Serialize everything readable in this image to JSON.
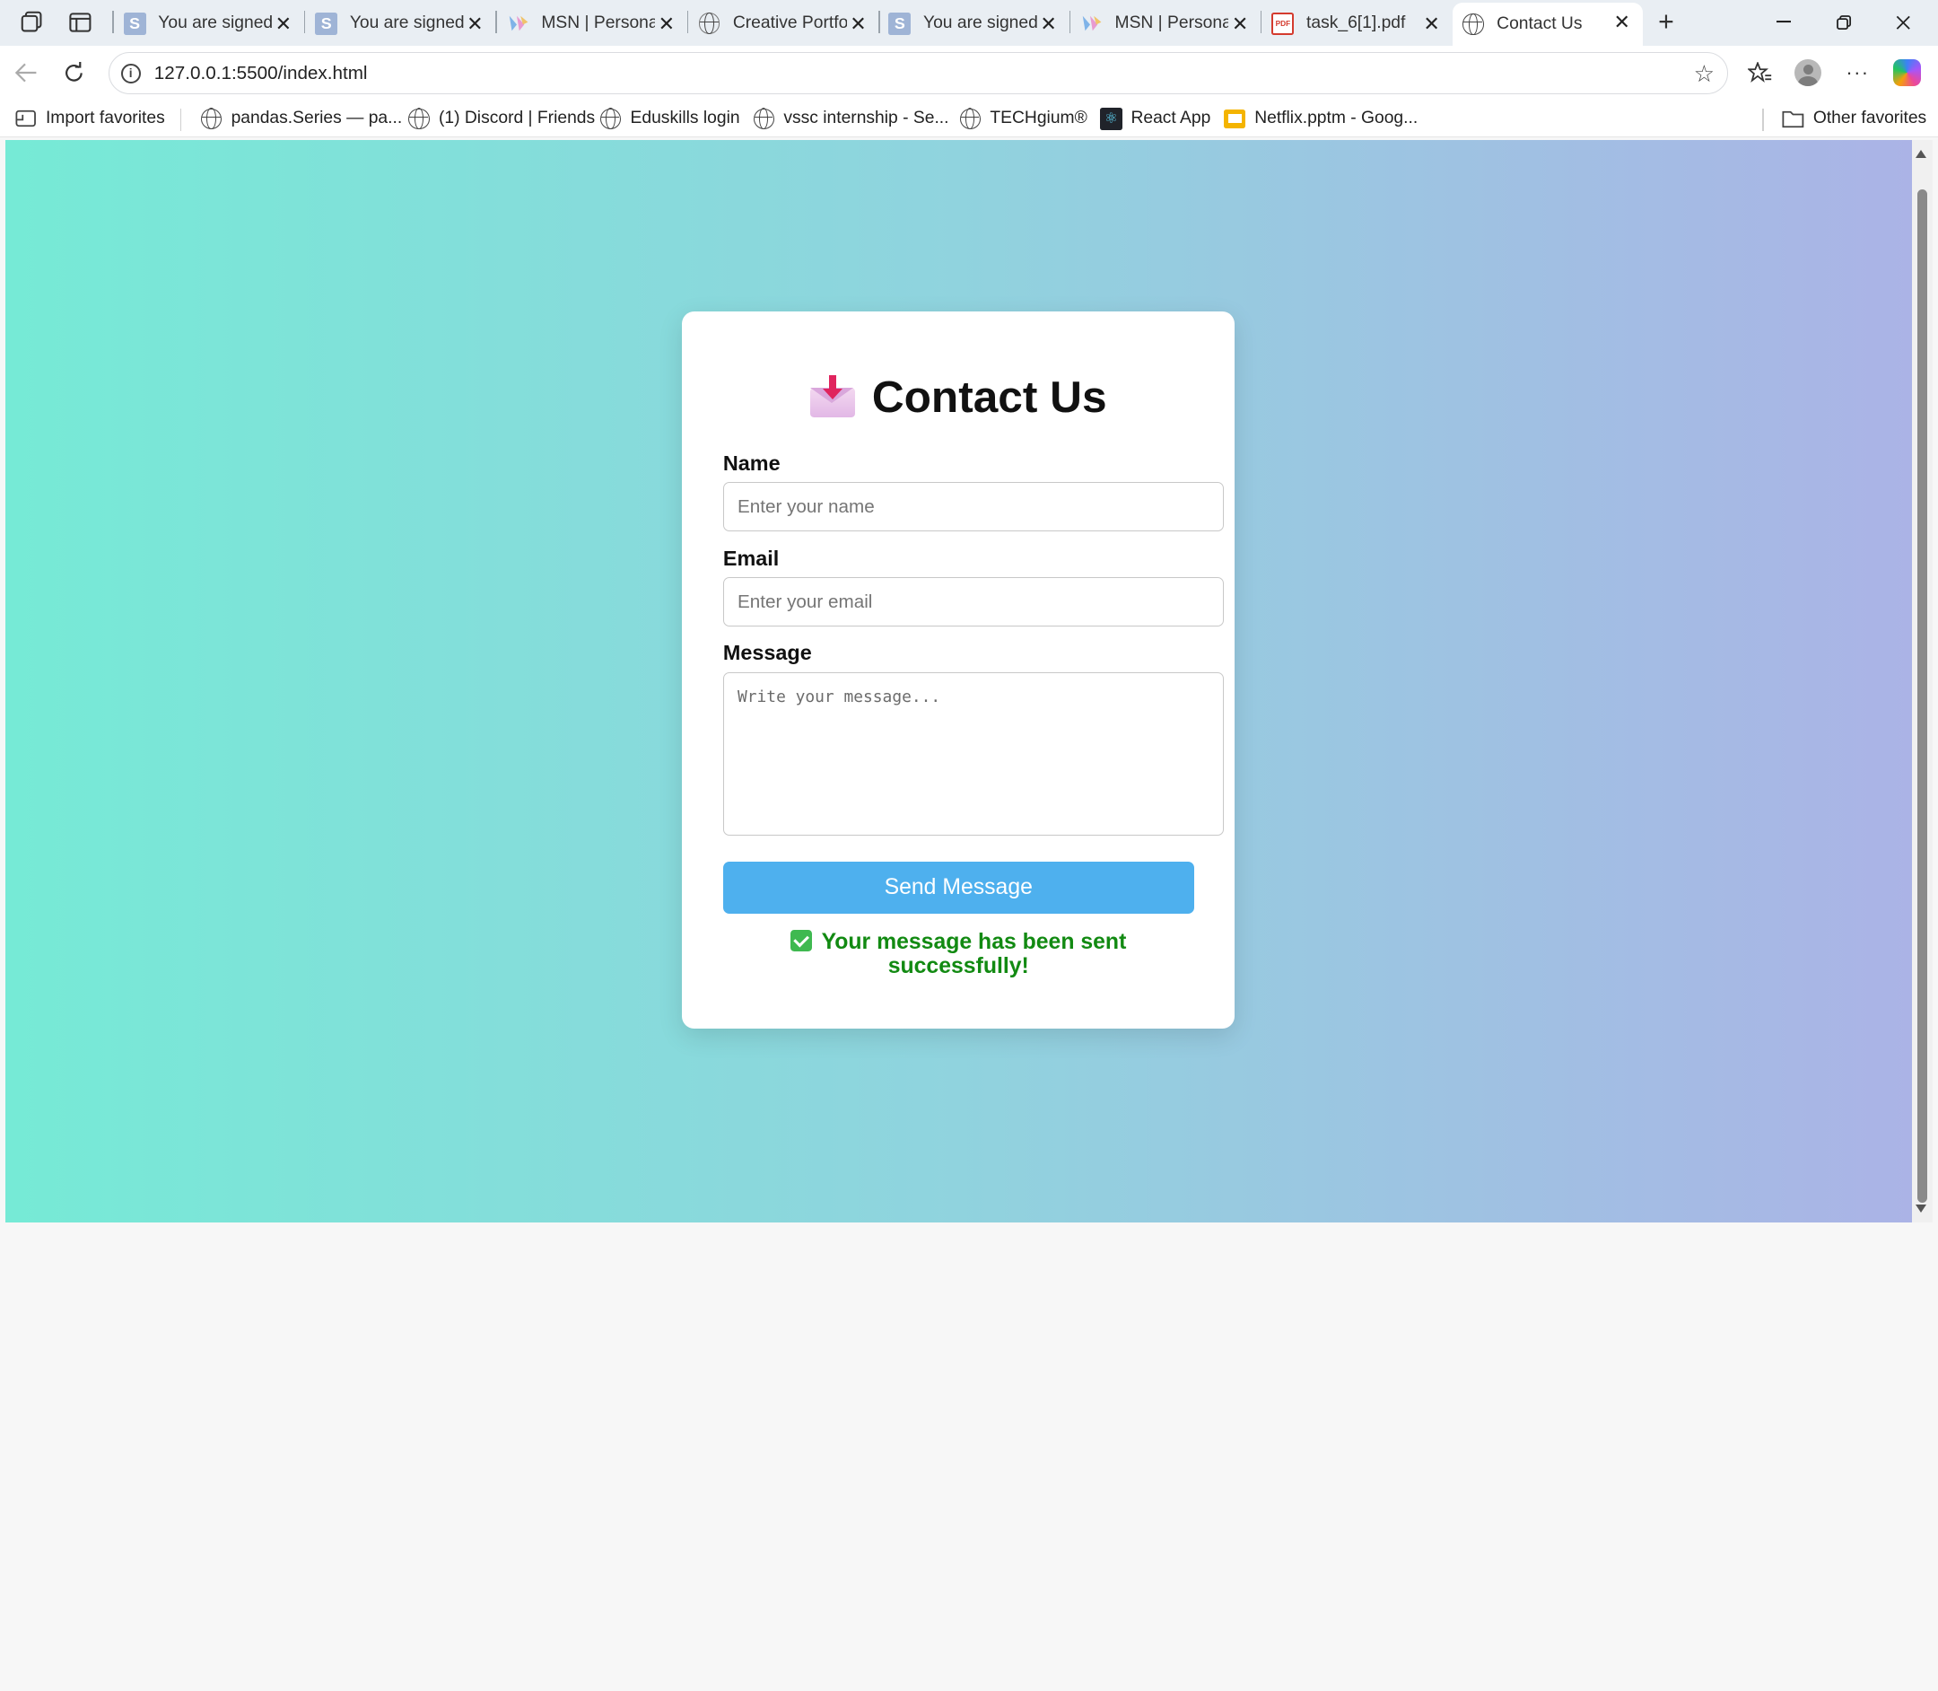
{
  "browser": {
    "tabs": [
      {
        "title": "You are signed",
        "icon": "s-icon"
      },
      {
        "title": "You are signed",
        "icon": "s-icon"
      },
      {
        "title": "MSN | Personal",
        "icon": "msn-icon"
      },
      {
        "title": "Creative Portfol",
        "icon": "globe-icon"
      },
      {
        "title": "You are signed",
        "icon": "s-icon"
      },
      {
        "title": "MSN | Personal",
        "icon": "msn-icon"
      },
      {
        "title": "task_6[1].pdf",
        "icon": "pdf-icon"
      },
      {
        "title": "Contact Us",
        "icon": "globe-icon",
        "active": true
      }
    ],
    "url": "127.0.0.1:5500/index.html",
    "favorites": [
      {
        "label": "Import favorites",
        "icon": "import-icon"
      },
      {
        "label": "pandas.Series — pa...",
        "icon": "globe-icon"
      },
      {
        "label": "(1) Discord | Friends",
        "icon": "globe-icon"
      },
      {
        "label": "Eduskills login",
        "icon": "globe-icon"
      },
      {
        "label": "vssc internship - Se...",
        "icon": "globe-icon"
      },
      {
        "label": "TECHgium®",
        "icon": "globe-icon"
      },
      {
        "label": "React App",
        "icon": "react-icon"
      },
      {
        "label": "Netflix.pptm - Goog...",
        "icon": "slides-icon"
      }
    ],
    "other_favorites": "Other favorites"
  },
  "form": {
    "title": "Contact Us",
    "name_label": "Name",
    "name_placeholder": "Enter your name",
    "email_label": "Email",
    "email_placeholder": "Enter your email",
    "message_label": "Message",
    "message_placeholder": "Write your message...",
    "submit_label": "Send Message",
    "success_message": "Your message has been sent successfully!"
  },
  "colors": {
    "gradient_start": "#76ead6",
    "gradient_end": "#abb3e6",
    "button": "#4eb0ee",
    "success": "#128a12"
  }
}
